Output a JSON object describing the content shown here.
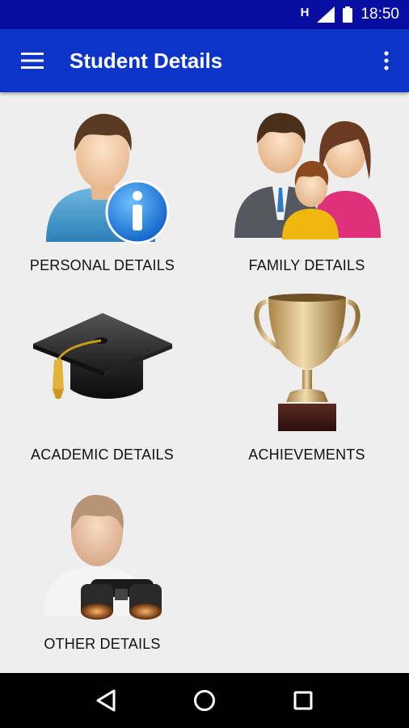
{
  "status_bar": {
    "network_indicator": "H",
    "time": "18:50",
    "icons": [
      "signal-icon",
      "battery-icon"
    ]
  },
  "app_bar": {
    "title": "Student Details",
    "menu_icon": "hamburger-menu-icon",
    "overflow_icon": "more-vert-icon",
    "color": "#0c34c8"
  },
  "tiles": [
    {
      "label": "PERSONAL DETAILS",
      "icon": "person-info-icon"
    },
    {
      "label": "FAMILY DETAILS",
      "icon": "family-icon"
    },
    {
      "label": "ACADEMIC DETAILS",
      "icon": "graduation-cap-icon"
    },
    {
      "label": "ACHIEVEMENTS",
      "icon": "trophy-icon"
    },
    {
      "label": "OTHER DETAILS",
      "icon": "person-binoculars-icon"
    }
  ],
  "nav_bar": {
    "buttons": [
      "back-icon",
      "home-icon",
      "recents-icon"
    ]
  }
}
